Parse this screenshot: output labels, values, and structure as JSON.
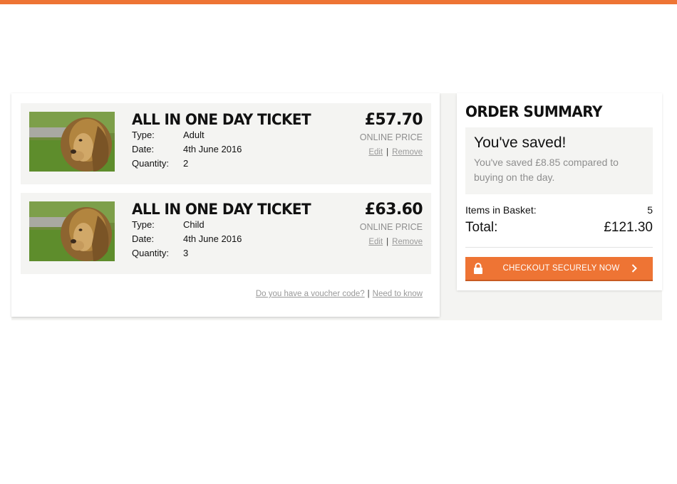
{
  "colors": {
    "accent": "#ee7434",
    "panel_bg": "#f4f4f2",
    "muted_text": "#8e8e8e"
  },
  "basket": {
    "items": [
      {
        "title": "ALL IN ONE DAY TICKET",
        "image_icon": "lion-photo",
        "type_label": "Type:",
        "type_value": "Adult",
        "date_label": "Date:",
        "date_value": "4th June 2016",
        "quantity_label": "Quantity:",
        "quantity_value": "2",
        "price": "£57.70",
        "price_note": "ONLINE PRICE",
        "edit_label": "Edit",
        "remove_label": "Remove",
        "separator": "|"
      },
      {
        "title": "ALL IN ONE DAY TICKET",
        "image_icon": "lion-photo",
        "type_label": "Type:",
        "type_value": "Child",
        "date_label": "Date:",
        "date_value": "4th June 2016",
        "quantity_label": "Quantity:",
        "quantity_value": "3",
        "price": "£63.60",
        "price_note": "ONLINE PRICE",
        "edit_label": "Edit",
        "remove_label": "Remove",
        "separator": "|"
      }
    ],
    "voucher_link": "Do you have a voucher code?",
    "links_separator": "|",
    "need_to_know_link": "Need to know"
  },
  "summary": {
    "title": "ORDER SUMMARY",
    "saved_heading": "You've saved!",
    "saved_text": "You've saved £8.85 compared to buying on the day.",
    "items_label": "Items in Basket:",
    "items_count": "5",
    "total_label": "Total:",
    "total_value": "£121.30",
    "checkout_label": "CHECKOUT SECURELY NOW",
    "checkout_icons": [
      "lock-icon",
      "chevron-right-icon"
    ]
  }
}
